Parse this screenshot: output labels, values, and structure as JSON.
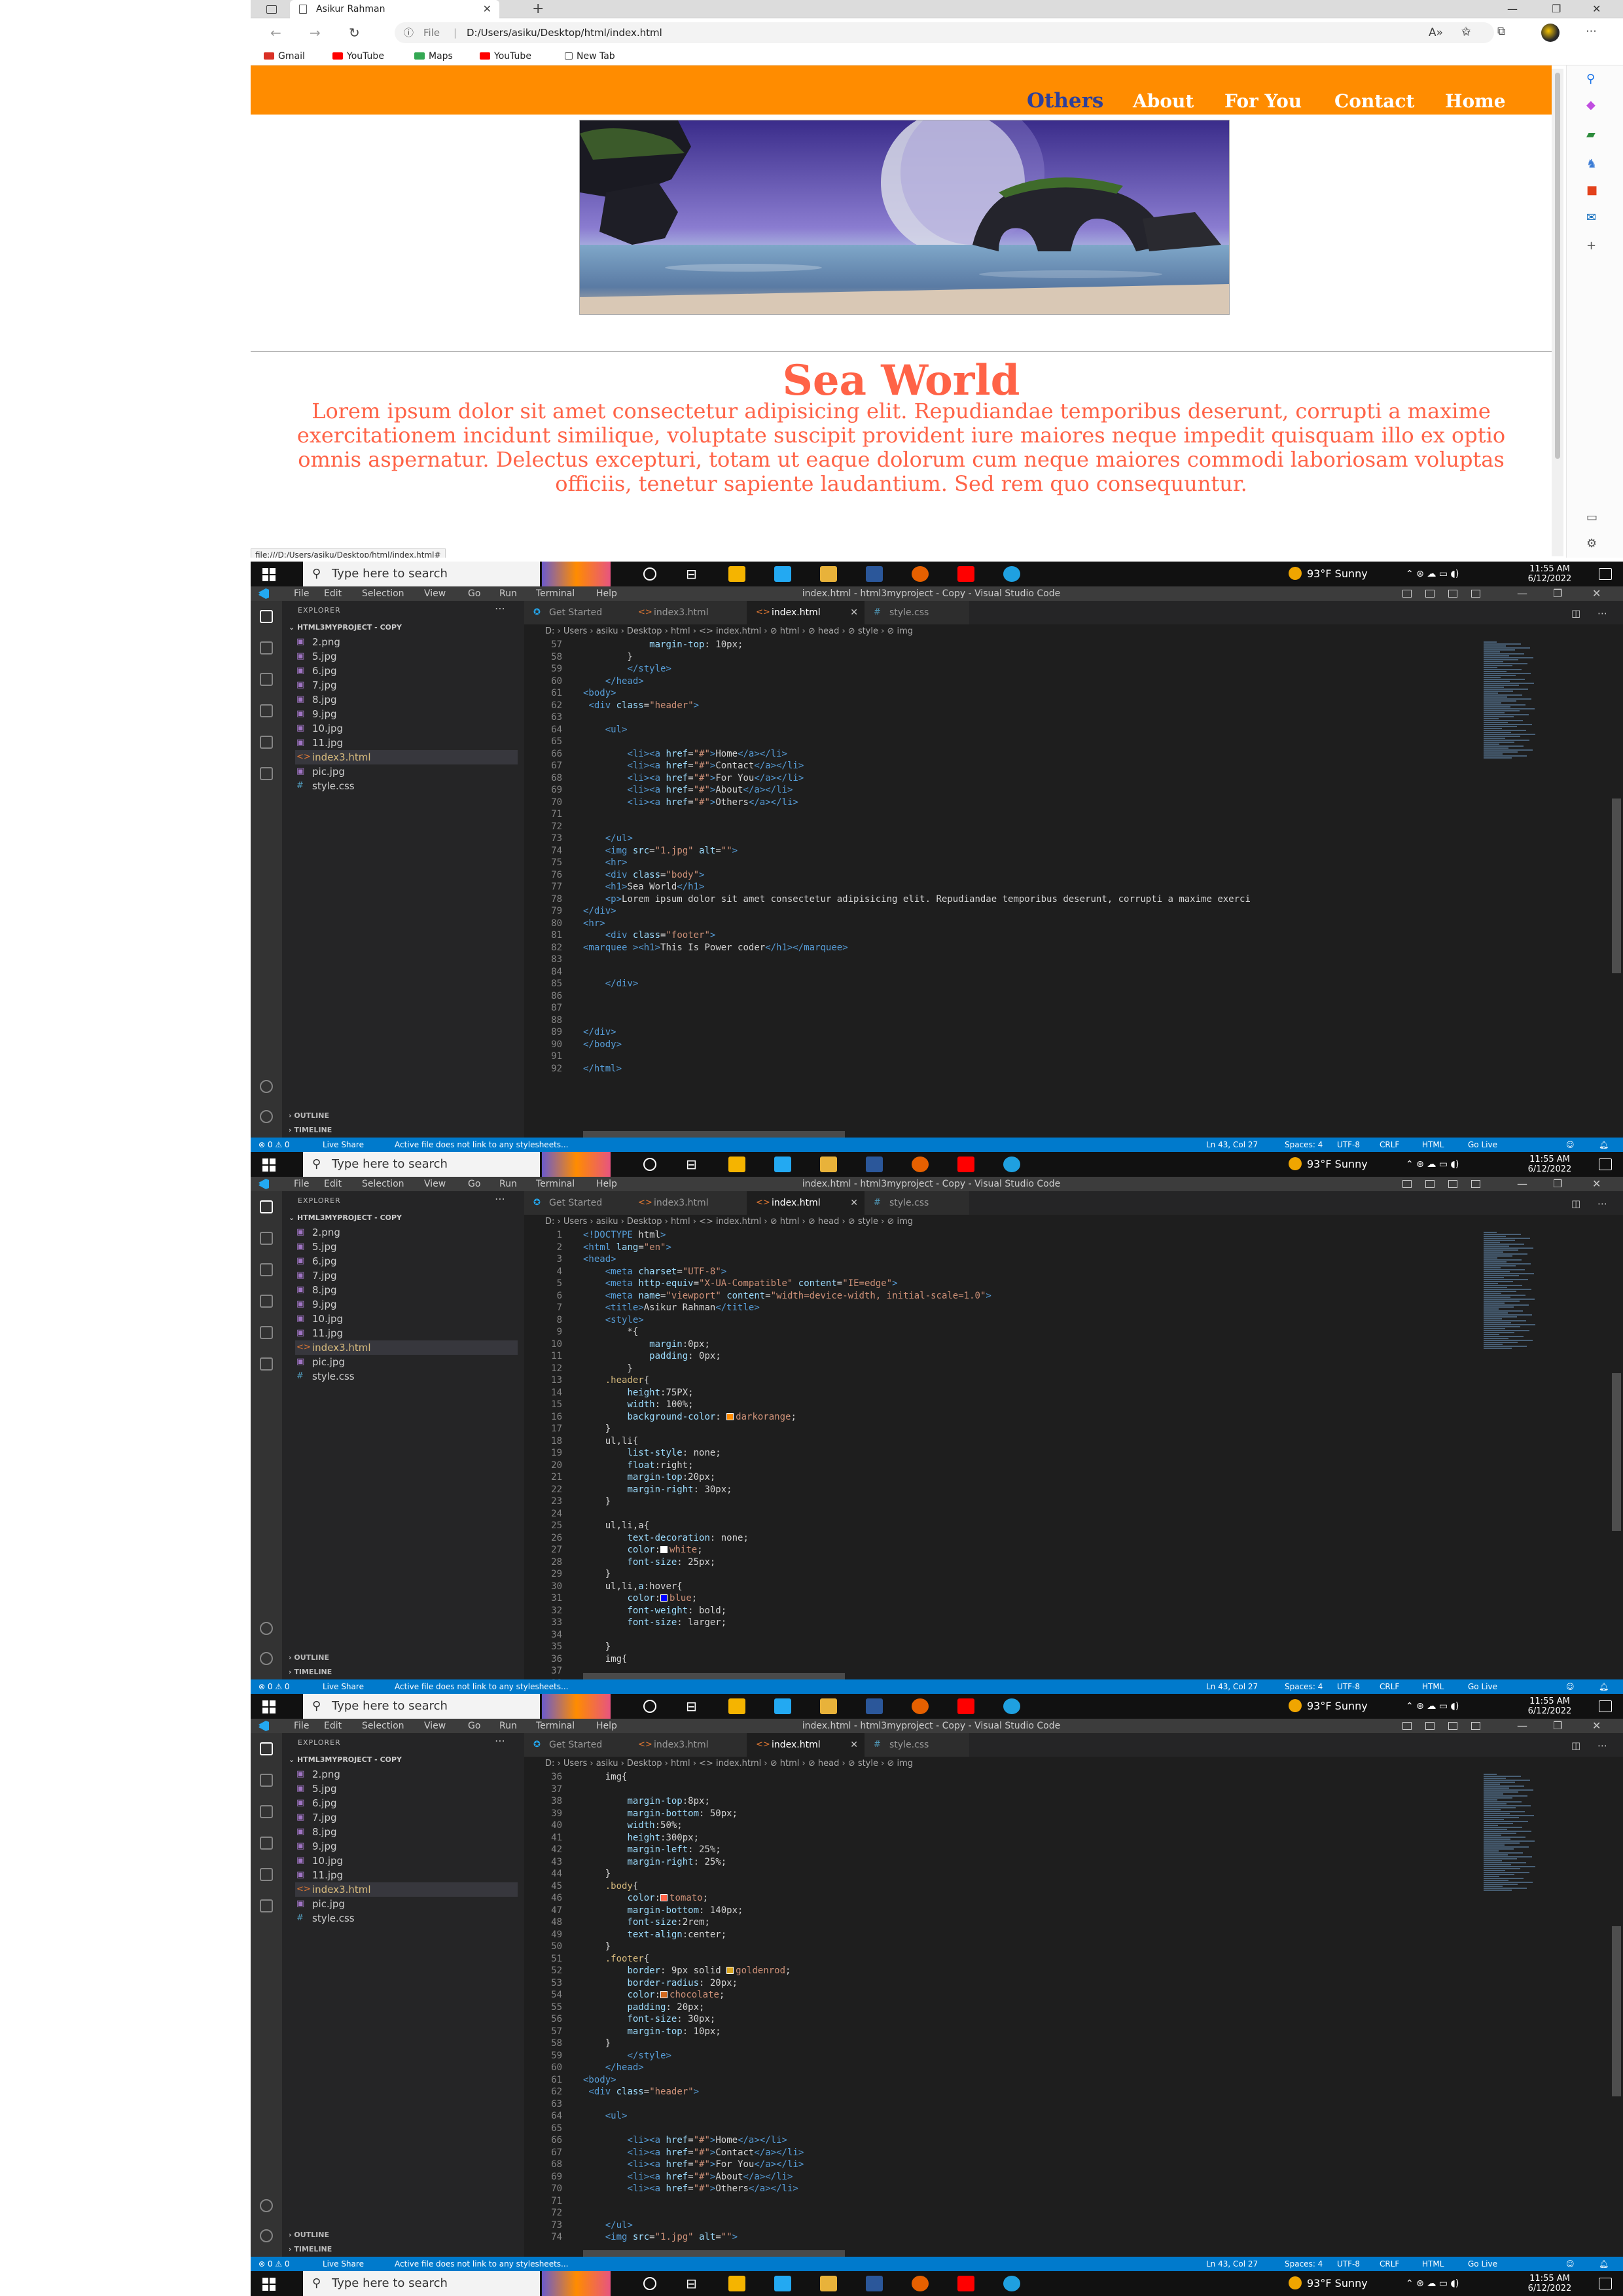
{
  "browser": {
    "tab_title": "Asikur Rahman",
    "url_scheme": "File",
    "url": "D:/Users/asiku/Desktop/html/index.html",
    "favorites": [
      "Gmail",
      "YouTube",
      "Maps",
      "YouTube",
      "New Tab"
    ],
    "status_url": "file:///D:/Users/asiku/Desktop/html/index.html#"
  },
  "website": {
    "nav": [
      "Others",
      "About",
      "For You",
      "Contact",
      "Home"
    ],
    "heading": "Sea World",
    "paragraph": "Lorem ipsum dolor sit amet consectetur adipisicing elit. Repudiandae temporibus deserunt, corrupti a maxime exercitationem incidunt similique, voluptate suscipit provident iure maiores neque impedit quisquam illo ex optio omnis aspernatur. Delectus excepturi, totam ut eaque dolorum cum neque maiores commodi laboriosam voluptas officiis, tenetur sapiente laudantium. Sed rem quo consequuntur.",
    "colors": {
      "header": "#ff8c00",
      "text": "#ff6347",
      "active_link": "#2d3f9a"
    }
  },
  "taskbar": {
    "search_placeholder": "Type here to search",
    "temperature": "93°F",
    "weather": "Sunny",
    "time": "11:55 AM",
    "date": "6/12/2022"
  },
  "vscode": {
    "menu": [
      "File",
      "Edit",
      "Selection",
      "View",
      "Go",
      "Run",
      "Terminal",
      "Help"
    ],
    "window_title": "index.html - html3myproject - Copy - Visual Studio Code",
    "explorer_title": "EXPLORER",
    "project": "HTML3MYPROJECT - COPY",
    "files": [
      "2.png",
      "5.jpg",
      "6.jpg",
      "7.jpg",
      "8.jpg",
      "9.jpg",
      "10.jpg",
      "11.jpg",
      "index3.html",
      "pic.jpg",
      "style.css"
    ],
    "outline": "OUTLINE",
    "timeline": "TIMELINE",
    "tabs": [
      "Get Started",
      "index3.html",
      "index.html",
      "style.css"
    ],
    "breadcrumb": "D: › Users › asiku › Desktop › html › <> index.html › ⊘ html › ⊘ head › ⊘ style › ⊘ img",
    "status": {
      "errors": "⊗ 0 ⚠ 0",
      "liveshare": "Live Share",
      "message": "Active file does not link to any stylesheets...",
      "position": "Ln 43, Col 27",
      "spaces": "Spaces: 4",
      "encoding": "UTF-8",
      "eol": "CRLF",
      "language": "HTML",
      "golive": "Go Live"
    }
  },
  "code_panel_1": {
    "lines": [
      [
        "57",
        "            margin-top: 10px;"
      ],
      [
        "58",
        "        }"
      ],
      [
        "59",
        "        </style>"
      ],
      [
        "60",
        "    </head>"
      ],
      [
        "61",
        "<body>"
      ],
      [
        "62",
        " <div class=\"header\">"
      ],
      [
        "63",
        ""
      ],
      [
        "64",
        "    <ul>"
      ],
      [
        "65",
        ""
      ],
      [
        "66",
        "        <li><a href=\"#\">Home</a></li>"
      ],
      [
        "67",
        "        <li><a href=\"#\">Contact</a></li>"
      ],
      [
        "68",
        "        <li><a href=\"#\">For You</a></li>"
      ],
      [
        "69",
        "        <li><a href=\"#\">About</a></li>"
      ],
      [
        "70",
        "        <li><a href=\"#\">Others</a></li>"
      ],
      [
        "71",
        ""
      ],
      [
        "72",
        ""
      ],
      [
        "73",
        "    </ul>"
      ],
      [
        "74",
        "    <img src=\"1.jpg\" alt=\"\">"
      ],
      [
        "75",
        "    <hr>"
      ],
      [
        "76",
        "    <div class=\"body\">"
      ],
      [
        "77",
        "    <h1>Sea World</h1>"
      ],
      [
        "78",
        "    <p>Lorem ipsum dolor sit amet consectetur adipisicing elit. Repudiandae temporibus deserunt, corrupti a maxime exerci"
      ],
      [
        "79",
        "</div>"
      ],
      [
        "80",
        "<hr>"
      ],
      [
        "81",
        "    <div class=\"footer\">"
      ],
      [
        "82",
        "<marquee ><h1>This Is Power coder</h1></marquee>"
      ],
      [
        "83",
        ""
      ],
      [
        "84",
        ""
      ],
      [
        "85",
        "    </div>"
      ],
      [
        "86",
        ""
      ],
      [
        "87",
        ""
      ],
      [
        "88",
        ""
      ],
      [
        "89",
        "</div>"
      ],
      [
        "90",
        "</body>"
      ],
      [
        "91",
        ""
      ],
      [
        "92",
        "</html>"
      ]
    ]
  },
  "code_panel_2": {
    "lines": [
      [
        "1",
        "<!DOCTYPE html>"
      ],
      [
        "2",
        "<html lang=\"en\">"
      ],
      [
        "3",
        "<head>"
      ],
      [
        "4",
        "    <meta charset=\"UTF-8\">"
      ],
      [
        "5",
        "    <meta http-equiv=\"X-UA-Compatible\" content=\"IE=edge\">"
      ],
      [
        "6",
        "    <meta name=\"viewport\" content=\"width=device-width, initial-scale=1.0\">"
      ],
      [
        "7",
        "    <title>Asikur Rahman</title>"
      ],
      [
        "8",
        "    <style>"
      ],
      [
        "9",
        "        *{"
      ],
      [
        "10",
        "            margin:0px;"
      ],
      [
        "11",
        "            padding: 0px;"
      ],
      [
        "12",
        "        }"
      ],
      [
        "13",
        "    .header{"
      ],
      [
        "14",
        "        height:75PX;"
      ],
      [
        "15",
        "        width: 100%;"
      ],
      [
        "16",
        "        background-color: ■darkorange;"
      ],
      [
        "17",
        "    }"
      ],
      [
        "18",
        "    ul,li{"
      ],
      [
        "19",
        "        list-style: none;"
      ],
      [
        "20",
        "        float:right;"
      ],
      [
        "21",
        "        margin-top:20px;"
      ],
      [
        "22",
        "        margin-right: 30px;"
      ],
      [
        "23",
        "    }"
      ],
      [
        "24",
        ""
      ],
      [
        "25",
        "    ul,li,a{"
      ],
      [
        "26",
        "        text-decoration: none;"
      ],
      [
        "27",
        "        color:□white;"
      ],
      [
        "28",
        "        font-size: 25px;"
      ],
      [
        "29",
        "    }"
      ],
      [
        "30",
        "    ul,li,a:hover{"
      ],
      [
        "31",
        "        color:■blue;"
      ],
      [
        "32",
        "        font-weight: bold;"
      ],
      [
        "33",
        "        font-size: larger;"
      ],
      [
        "34",
        ""
      ],
      [
        "35",
        "    }"
      ],
      [
        "36",
        "    img{"
      ],
      [
        "37",
        ""
      ],
      [
        "38",
        "        margin-top:8px;"
      ],
      [
        "39",
        "        margin-bottom: 50px;"
      ]
    ]
  },
  "code_panel_3": {
    "lines": [
      [
        "36",
        "    img{"
      ],
      [
        "37",
        ""
      ],
      [
        "38",
        "        margin-top:8px;"
      ],
      [
        "39",
        "        margin-bottom: 50px;"
      ],
      [
        "40",
        "        width:50%;"
      ],
      [
        "41",
        "        height:300px;"
      ],
      [
        "42",
        "        margin-left: 25%;"
      ],
      [
        "43",
        "        margin-right: 25%;"
      ],
      [
        "44",
        "    }"
      ],
      [
        "45",
        "    .body{"
      ],
      [
        "46",
        "        color:■tomato;"
      ],
      [
        "47",
        "        margin-bottom: 140px;"
      ],
      [
        "48",
        "        font-size:2rem;"
      ],
      [
        "49",
        "        text-align:center;"
      ],
      [
        "50",
        "    }"
      ],
      [
        "51",
        "    .footer{"
      ],
      [
        "52",
        "        border: 9px solid ■goldenrod;"
      ],
      [
        "53",
        "        border-radius: 20px;"
      ],
      [
        "54",
        "        color:■chocolate;"
      ],
      [
        "55",
        "        padding: 20px;"
      ],
      [
        "56",
        "        font-size: 30px;"
      ],
      [
        "57",
        "        margin-top: 10px;"
      ],
      [
        "58",
        "    }"
      ],
      [
        "59",
        "        </style>"
      ],
      [
        "60",
        "    </head>"
      ],
      [
        "61",
        "<body>"
      ],
      [
        "62",
        " <div class=\"header\">"
      ],
      [
        "63",
        ""
      ],
      [
        "64",
        "    <ul>"
      ],
      [
        "65",
        ""
      ],
      [
        "66",
        "        <li><a href=\"#\">Home</a></li>"
      ],
      [
        "67",
        "        <li><a href=\"#\">Contact</a></li>"
      ],
      [
        "68",
        "        <li><a href=\"#\">For You</a></li>"
      ],
      [
        "69",
        "        <li><a href=\"#\">About</a></li>"
      ],
      [
        "70",
        "        <li><a href=\"#\">Others</a></li>"
      ],
      [
        "71",
        ""
      ],
      [
        "72",
        ""
      ],
      [
        "73",
        "    </ul>"
      ],
      [
        "74",
        "    <img src=\"1.jpg\" alt=\"\">"
      ]
    ]
  }
}
